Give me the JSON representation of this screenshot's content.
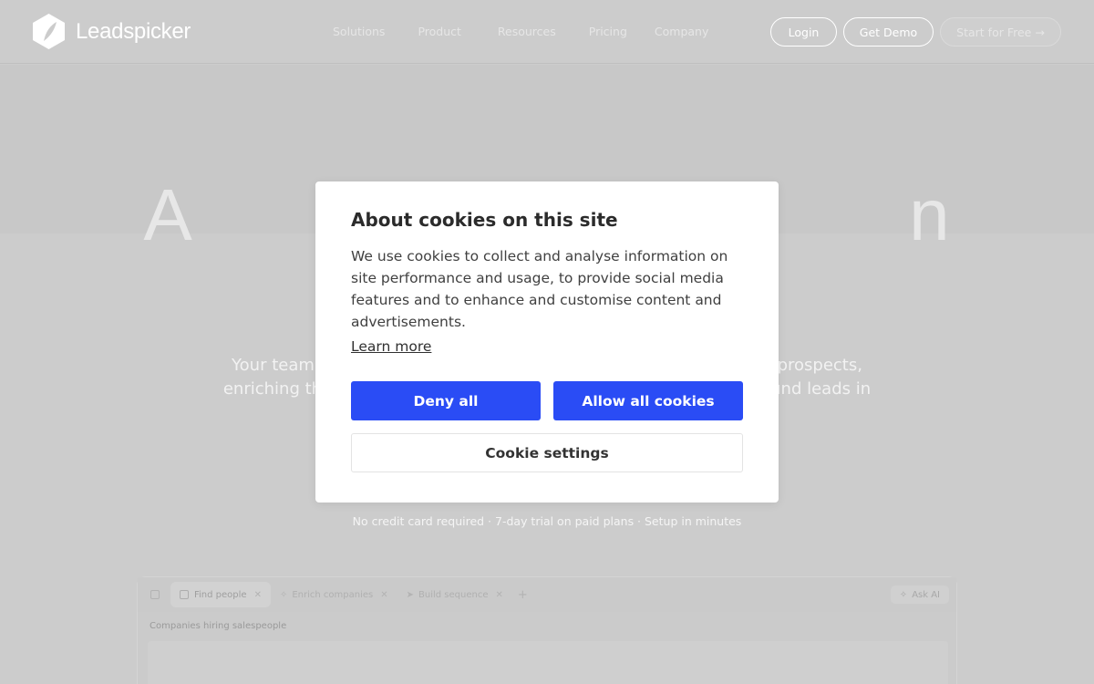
{
  "nav": {
    "brand": "Leadspicker",
    "links": [
      "Solutions",
      "Product",
      "Resources",
      "Pricing",
      "Company"
    ],
    "login": "Login",
    "get_demo": "Get Demo",
    "start_free": "Start for Free →"
  },
  "hero": {
    "title_partial": "A                                  n",
    "subtitle": "Your team c                                                                                      prospects, enriching th                                                                                      und leads in",
    "note": "No credit card required · 7-day trial on paid plans · Setup in minutes"
  },
  "app_preview": {
    "tabs": [
      "Find people",
      "Enrich companies",
      "Build sequence"
    ],
    "ask_ai": "Ask AI",
    "section_label": "Companies hiring salespeople"
  },
  "cookie_dialog": {
    "title": "About cookies on this site",
    "body": "We use cookies to collect and analyse information on site performance and usage, to provide social media features and to enhance and customise content and advertisements.",
    "learn_more": "Learn more",
    "deny_all": "Deny all",
    "allow_all": "Allow all cookies",
    "settings": "Cookie settings"
  },
  "colors": {
    "overlay_background": "#cccccc",
    "primary_button": "#2a4cf5",
    "dialog_background": "#ffffff"
  }
}
